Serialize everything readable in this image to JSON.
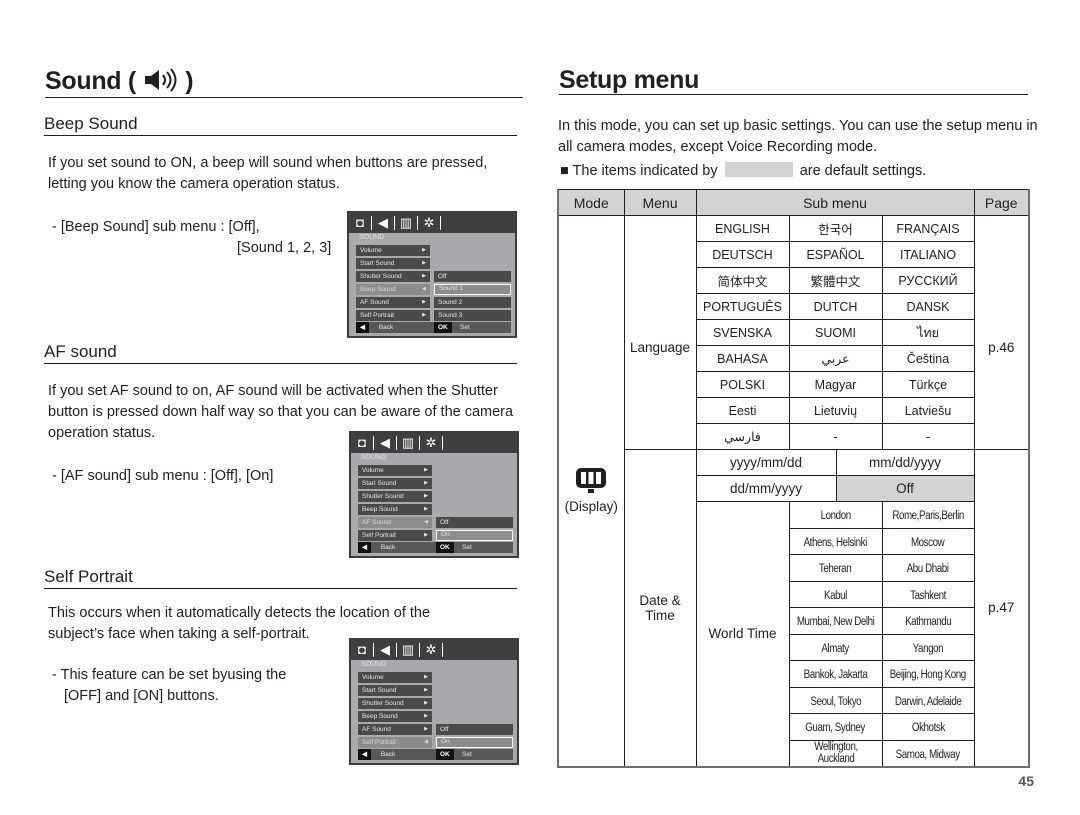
{
  "left": {
    "title": "Sound (",
    "title_icon": "speaker-icon",
    "title_close": ")",
    "sections": [
      {
        "heading": "Beep Sound",
        "body": "If you set sound to ON, a beep will sound when buttons are pressed, letting you know the camera operation status.",
        "note_line1": "- [Beep Sound] sub menu : [Off],",
        "note_line2": "[Sound 1, 2, 3]"
      },
      {
        "heading": "AF sound",
        "body": "If you set AF sound to on, AF sound will be activated when the Shutter button is pressed down half way so that you can be aware of the camera operation status.",
        "note_line1": "- [AF sound] sub menu : [Off], [On]"
      },
      {
        "heading": "Self Portrait",
        "body": "This occurs when it automatically detects the location of the subject’s face when taking a self-portrait.",
        "note_line1": "- This feature can be set byusing the",
        "note_line2": "[OFF] and [ON] buttons."
      }
    ],
    "lcd_screens": [
      {
        "tabs": [
          "camera-icon",
          "sound-icon",
          "display-icon",
          "settings-icon"
        ],
        "title": "SOUND",
        "items": [
          "Volume",
          "Start Sound",
          "Shutter Sound",
          "Beep Sound",
          "AF Sound",
          "Self Portrait"
        ],
        "selected_item": "Beep Sound",
        "options": [
          "Off",
          "Sound 1",
          "Sound 2",
          "Sound 3"
        ],
        "selected_option": "Sound 1",
        "back_key": "◀",
        "back_label": "Back",
        "ok_key": "OK",
        "ok_label": "Set"
      },
      {
        "title": "SOUND",
        "items": [
          "Volume",
          "Start Sound",
          "Shutter Sound",
          "Beep Sound",
          "AF Sound",
          "Self Portrait"
        ],
        "selected_item": "AF Sound",
        "options": [
          "Off",
          "On"
        ],
        "selected_option": "On",
        "back_key": "◀",
        "back_label": "Back",
        "ok_key": "OK",
        "ok_label": "Set"
      },
      {
        "title": "SOUND",
        "items": [
          "Volume",
          "Start Sound",
          "Shutter Sound",
          "Beep Sound",
          "AF Sound",
          "Self Portrait"
        ],
        "selected_item": "Self Portrait",
        "options": [
          "Off",
          "On"
        ],
        "selected_option": "On",
        "back_key": "◀",
        "back_label": "Back",
        "ok_key": "OK",
        "ok_label": "Set"
      }
    ]
  },
  "right": {
    "title": "Setup menu",
    "intro": "In this mode, you can set up basic settings. You can use the setup menu in all camera modes, except Voice Recording mode.",
    "legend_prefix": "The items indicated by",
    "legend_suffix": "are default settings.",
    "default_color": "#d1d3d4",
    "table": {
      "headers": [
        "Mode",
        "Menu",
        "Sub menu",
        "Page"
      ],
      "mode_label": "(Display)",
      "mode_icon": "display-icon",
      "language": {
        "menu": "Language",
        "page": "p.46",
        "rows": [
          [
            "ENGLISH",
            "한국어",
            "FRANÇAIS"
          ],
          [
            "DEUTSCH",
            "ESPAÑOL",
            "ITALIANO"
          ],
          [
            "简体中文",
            "繁體中文",
            "РУССКИЙ"
          ],
          [
            "PORTUGUÊS",
            "DUTCH",
            "DANSK"
          ],
          [
            "SVENSKA",
            "SUOMI",
            "ไทย"
          ],
          [
            "BAHASA",
            "عربي",
            "Čeština"
          ],
          [
            "POLSKI",
            "Magyar",
            "Türkçe"
          ],
          [
            "Eesti",
            "Lietuvių",
            "Latviešu"
          ],
          [
            "فارسي",
            "-",
            "-"
          ]
        ]
      },
      "date_time": {
        "menu": "Date & Time",
        "page": "p.47",
        "formats": [
          [
            "yyyy/mm/dd",
            "mm/dd/yyyy"
          ],
          [
            "dd/mm/yyyy",
            "Off"
          ]
        ],
        "default_format": "Off",
        "world_time_label": "World Time",
        "world_time": [
          [
            "London",
            "Rome,Paris,Berlin"
          ],
          [
            "Athens, Helsinki",
            "Moscow"
          ],
          [
            "Teheran",
            "Abu Dhabi"
          ],
          [
            "Kabul",
            "Tashkent"
          ],
          [
            "Mumbai, New Delhi",
            "Kathmandu"
          ],
          [
            "Almaty",
            "Yangon"
          ],
          [
            "Bankok, Jakarta",
            "Beijing, Hong Kong"
          ],
          [
            "Seoul, Tokyo",
            "Darwin, Adelaide"
          ],
          [
            "Guam, Sydney",
            "Okhotsk"
          ],
          [
            "Wellington, Auckland",
            "Samoa, Midway"
          ]
        ]
      }
    }
  },
  "page_number": "45"
}
